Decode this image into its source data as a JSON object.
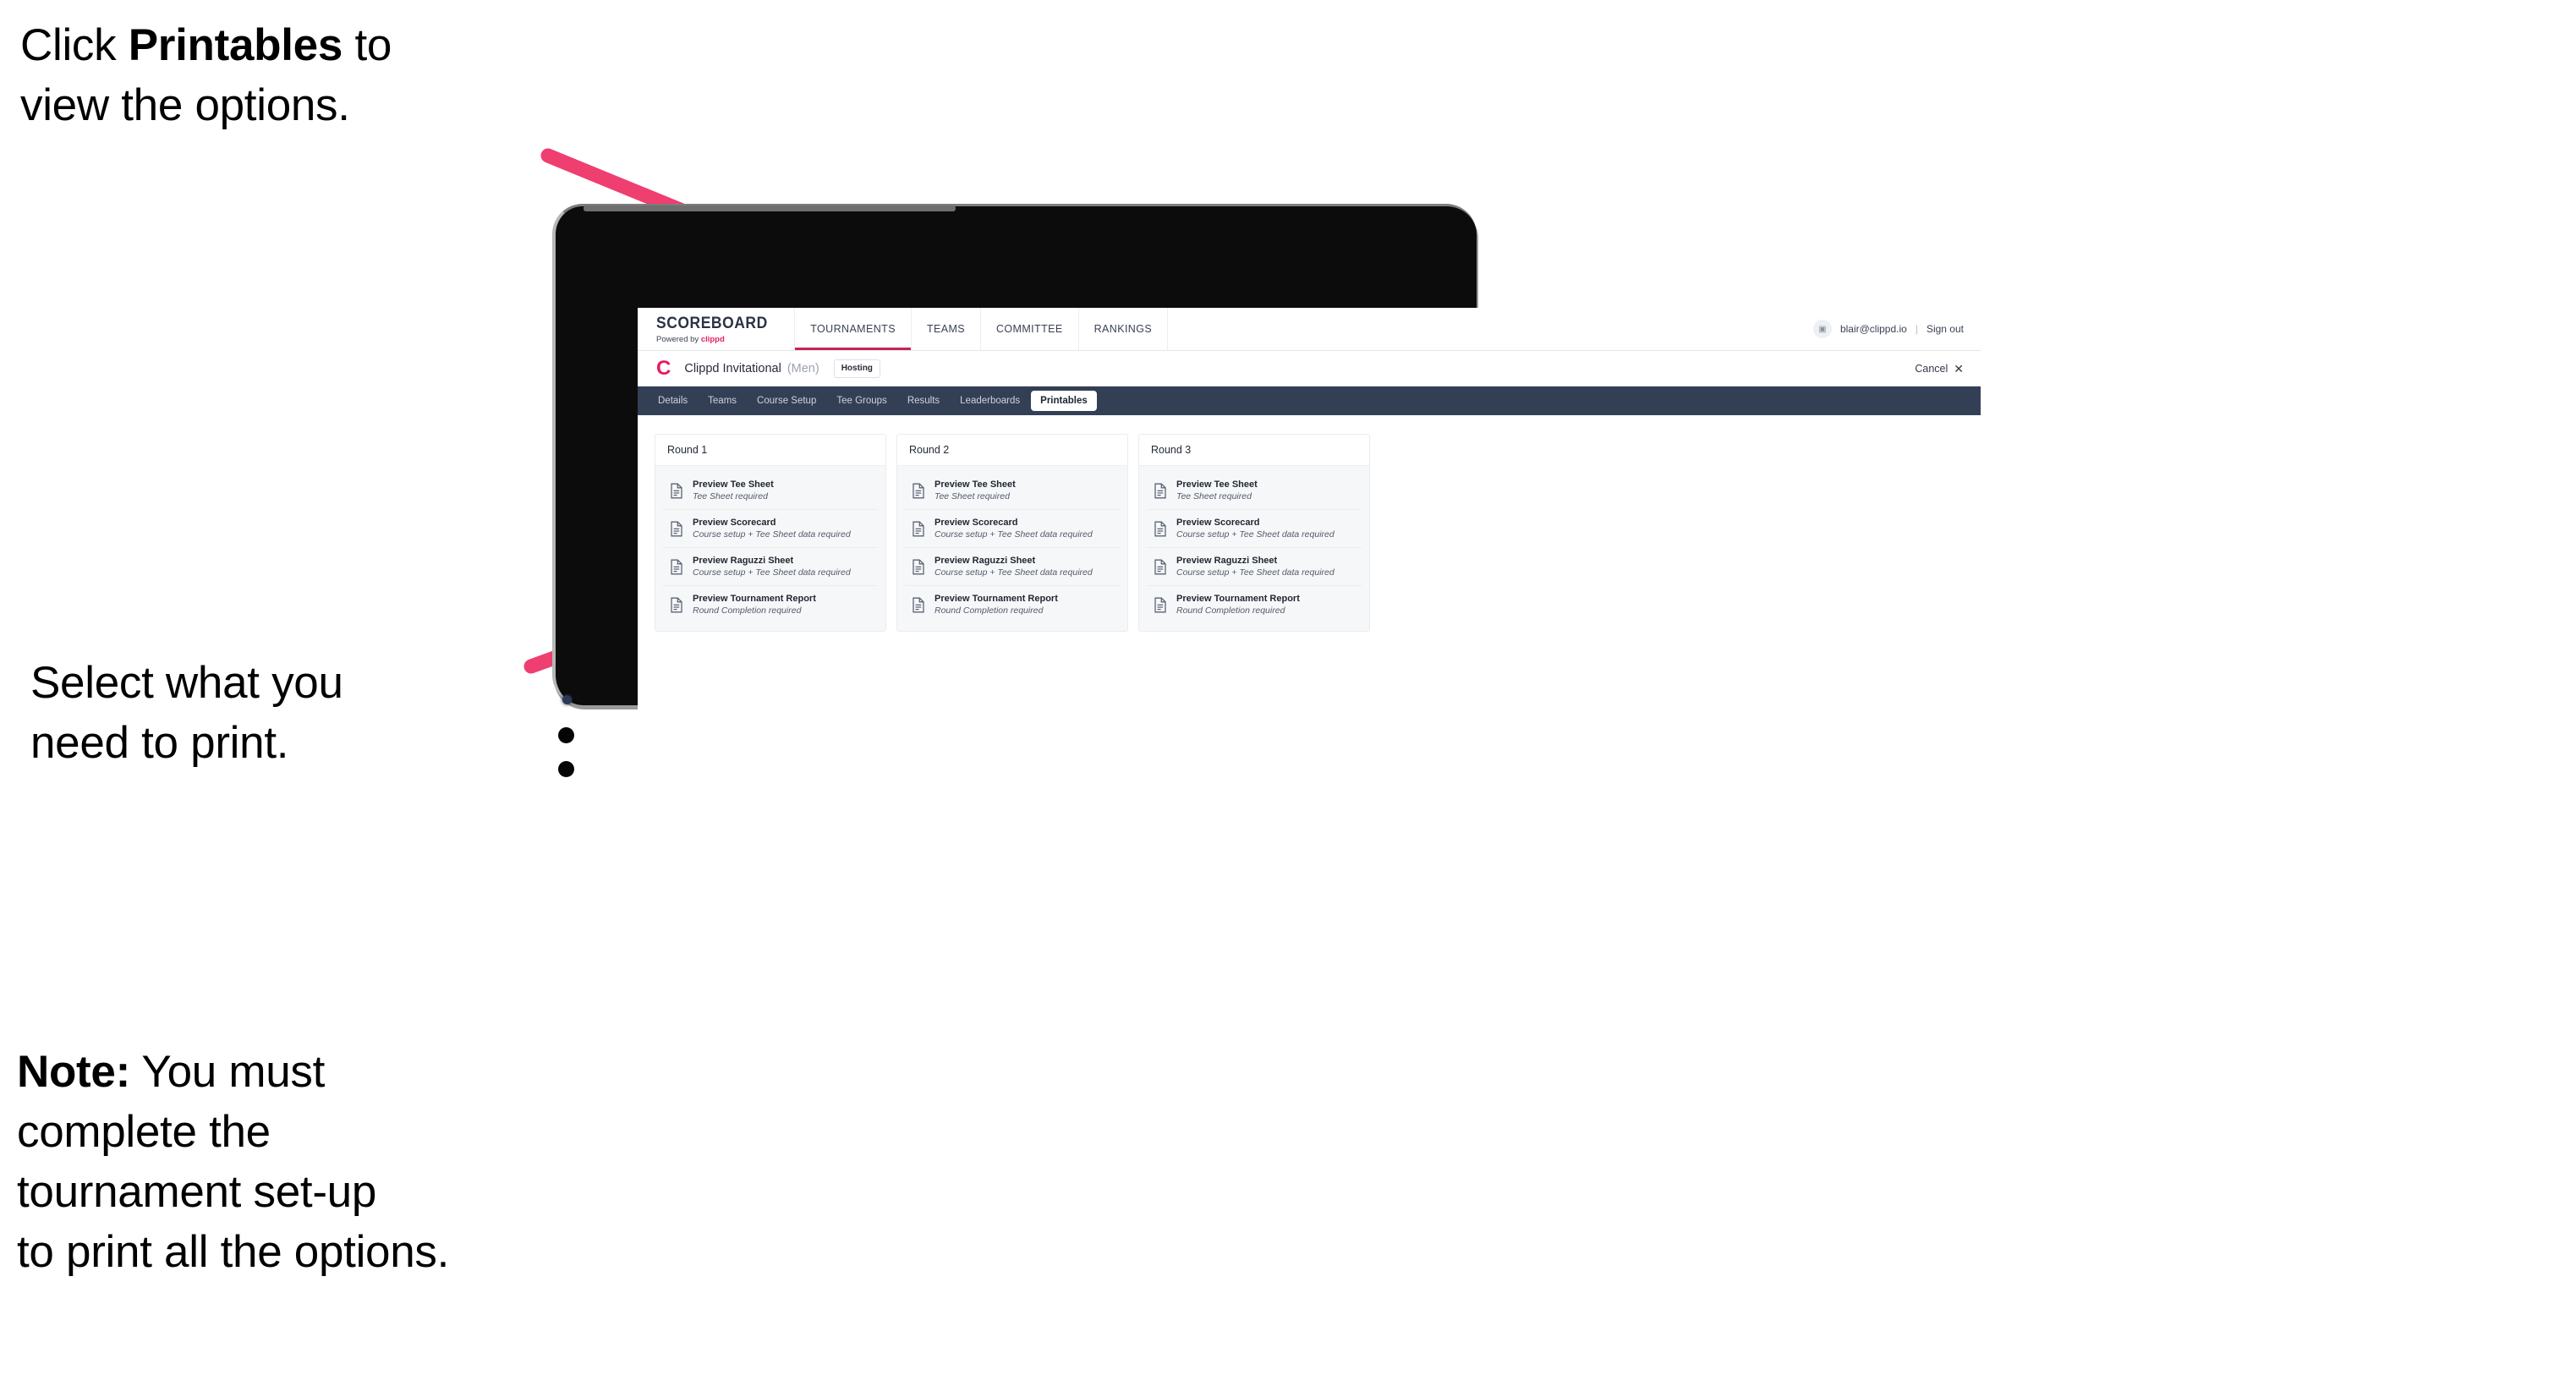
{
  "annotations": {
    "top": {
      "prefix": "Click ",
      "bold": "Printables",
      "suffix": " to\nview the options."
    },
    "middle": {
      "text": "Select what you\n need to print."
    },
    "note": {
      "bold": "Note:",
      "text": " You must\ncomplete the\ntournament set-up\nto print all the options."
    }
  },
  "app": {
    "brand": {
      "title": "SCOREBOARD",
      "powered_prefix": "Powered by ",
      "powered_brand": "clippd"
    },
    "main_nav": [
      {
        "label": "TOURNAMENTS",
        "active": true
      },
      {
        "label": "TEAMS",
        "active": false
      },
      {
        "label": "COMMITTEE",
        "active": false
      },
      {
        "label": "RANKINGS",
        "active": false
      }
    ],
    "account": {
      "avatar_icon": "user-avatar-icon",
      "email": "blair@clippd.io",
      "separator": "|",
      "sign_out": "Sign out"
    },
    "tournament": {
      "logo_letter": "C",
      "name": "Clippd Invitational",
      "gender": "(Men)",
      "status": "Hosting",
      "cancel_label": "Cancel",
      "cancel_icon": "close-icon"
    },
    "sub_nav": [
      {
        "label": "Details",
        "active": false
      },
      {
        "label": "Teams",
        "active": false
      },
      {
        "label": "Course Setup",
        "active": false
      },
      {
        "label": "Tee Groups",
        "active": false
      },
      {
        "label": "Results",
        "active": false
      },
      {
        "label": "Leaderboards",
        "active": false
      },
      {
        "label": "Printables",
        "active": true
      }
    ],
    "rounds": [
      {
        "title": "Round 1",
        "items": [
          {
            "title": "Preview Tee Sheet",
            "subtitle": "Tee Sheet required",
            "icon": "document-icon"
          },
          {
            "title": "Preview Scorecard",
            "subtitle": "Course setup + Tee Sheet data required",
            "icon": "document-icon"
          },
          {
            "title": "Preview Raguzzi Sheet",
            "subtitle": "Course setup + Tee Sheet data required",
            "icon": "document-icon"
          },
          {
            "title": "Preview Tournament Report",
            "subtitle": "Round Completion required",
            "icon": "document-icon"
          }
        ]
      },
      {
        "title": "Round 2",
        "items": [
          {
            "title": "Preview Tee Sheet",
            "subtitle": "Tee Sheet required",
            "icon": "document-icon"
          },
          {
            "title": "Preview Scorecard",
            "subtitle": "Course setup + Tee Sheet data required",
            "icon": "document-icon"
          },
          {
            "title": "Preview Raguzzi Sheet",
            "subtitle": "Course setup + Tee Sheet data required",
            "icon": "document-icon"
          },
          {
            "title": "Preview Tournament Report",
            "subtitle": "Round Completion required",
            "icon": "document-icon"
          }
        ]
      },
      {
        "title": "Round 3",
        "items": [
          {
            "title": "Preview Tee Sheet",
            "subtitle": "Tee Sheet required",
            "icon": "document-icon"
          },
          {
            "title": "Preview Scorecard",
            "subtitle": "Course setup + Tee Sheet data required",
            "icon": "document-icon"
          },
          {
            "title": "Preview Raguzzi Sheet",
            "subtitle": "Course setup + Tee Sheet data required",
            "icon": "document-icon"
          },
          {
            "title": "Preview Tournament Report",
            "subtitle": "Round Completion required",
            "icon": "document-icon"
          }
        ]
      }
    ]
  },
  "colors": {
    "accent_pink": "#e51f5c",
    "arrow_pink": "#ef3e70",
    "subnav_dark": "#333f55",
    "nav_underline": "#c2255c",
    "bezel_black": "#0c0c0c"
  }
}
